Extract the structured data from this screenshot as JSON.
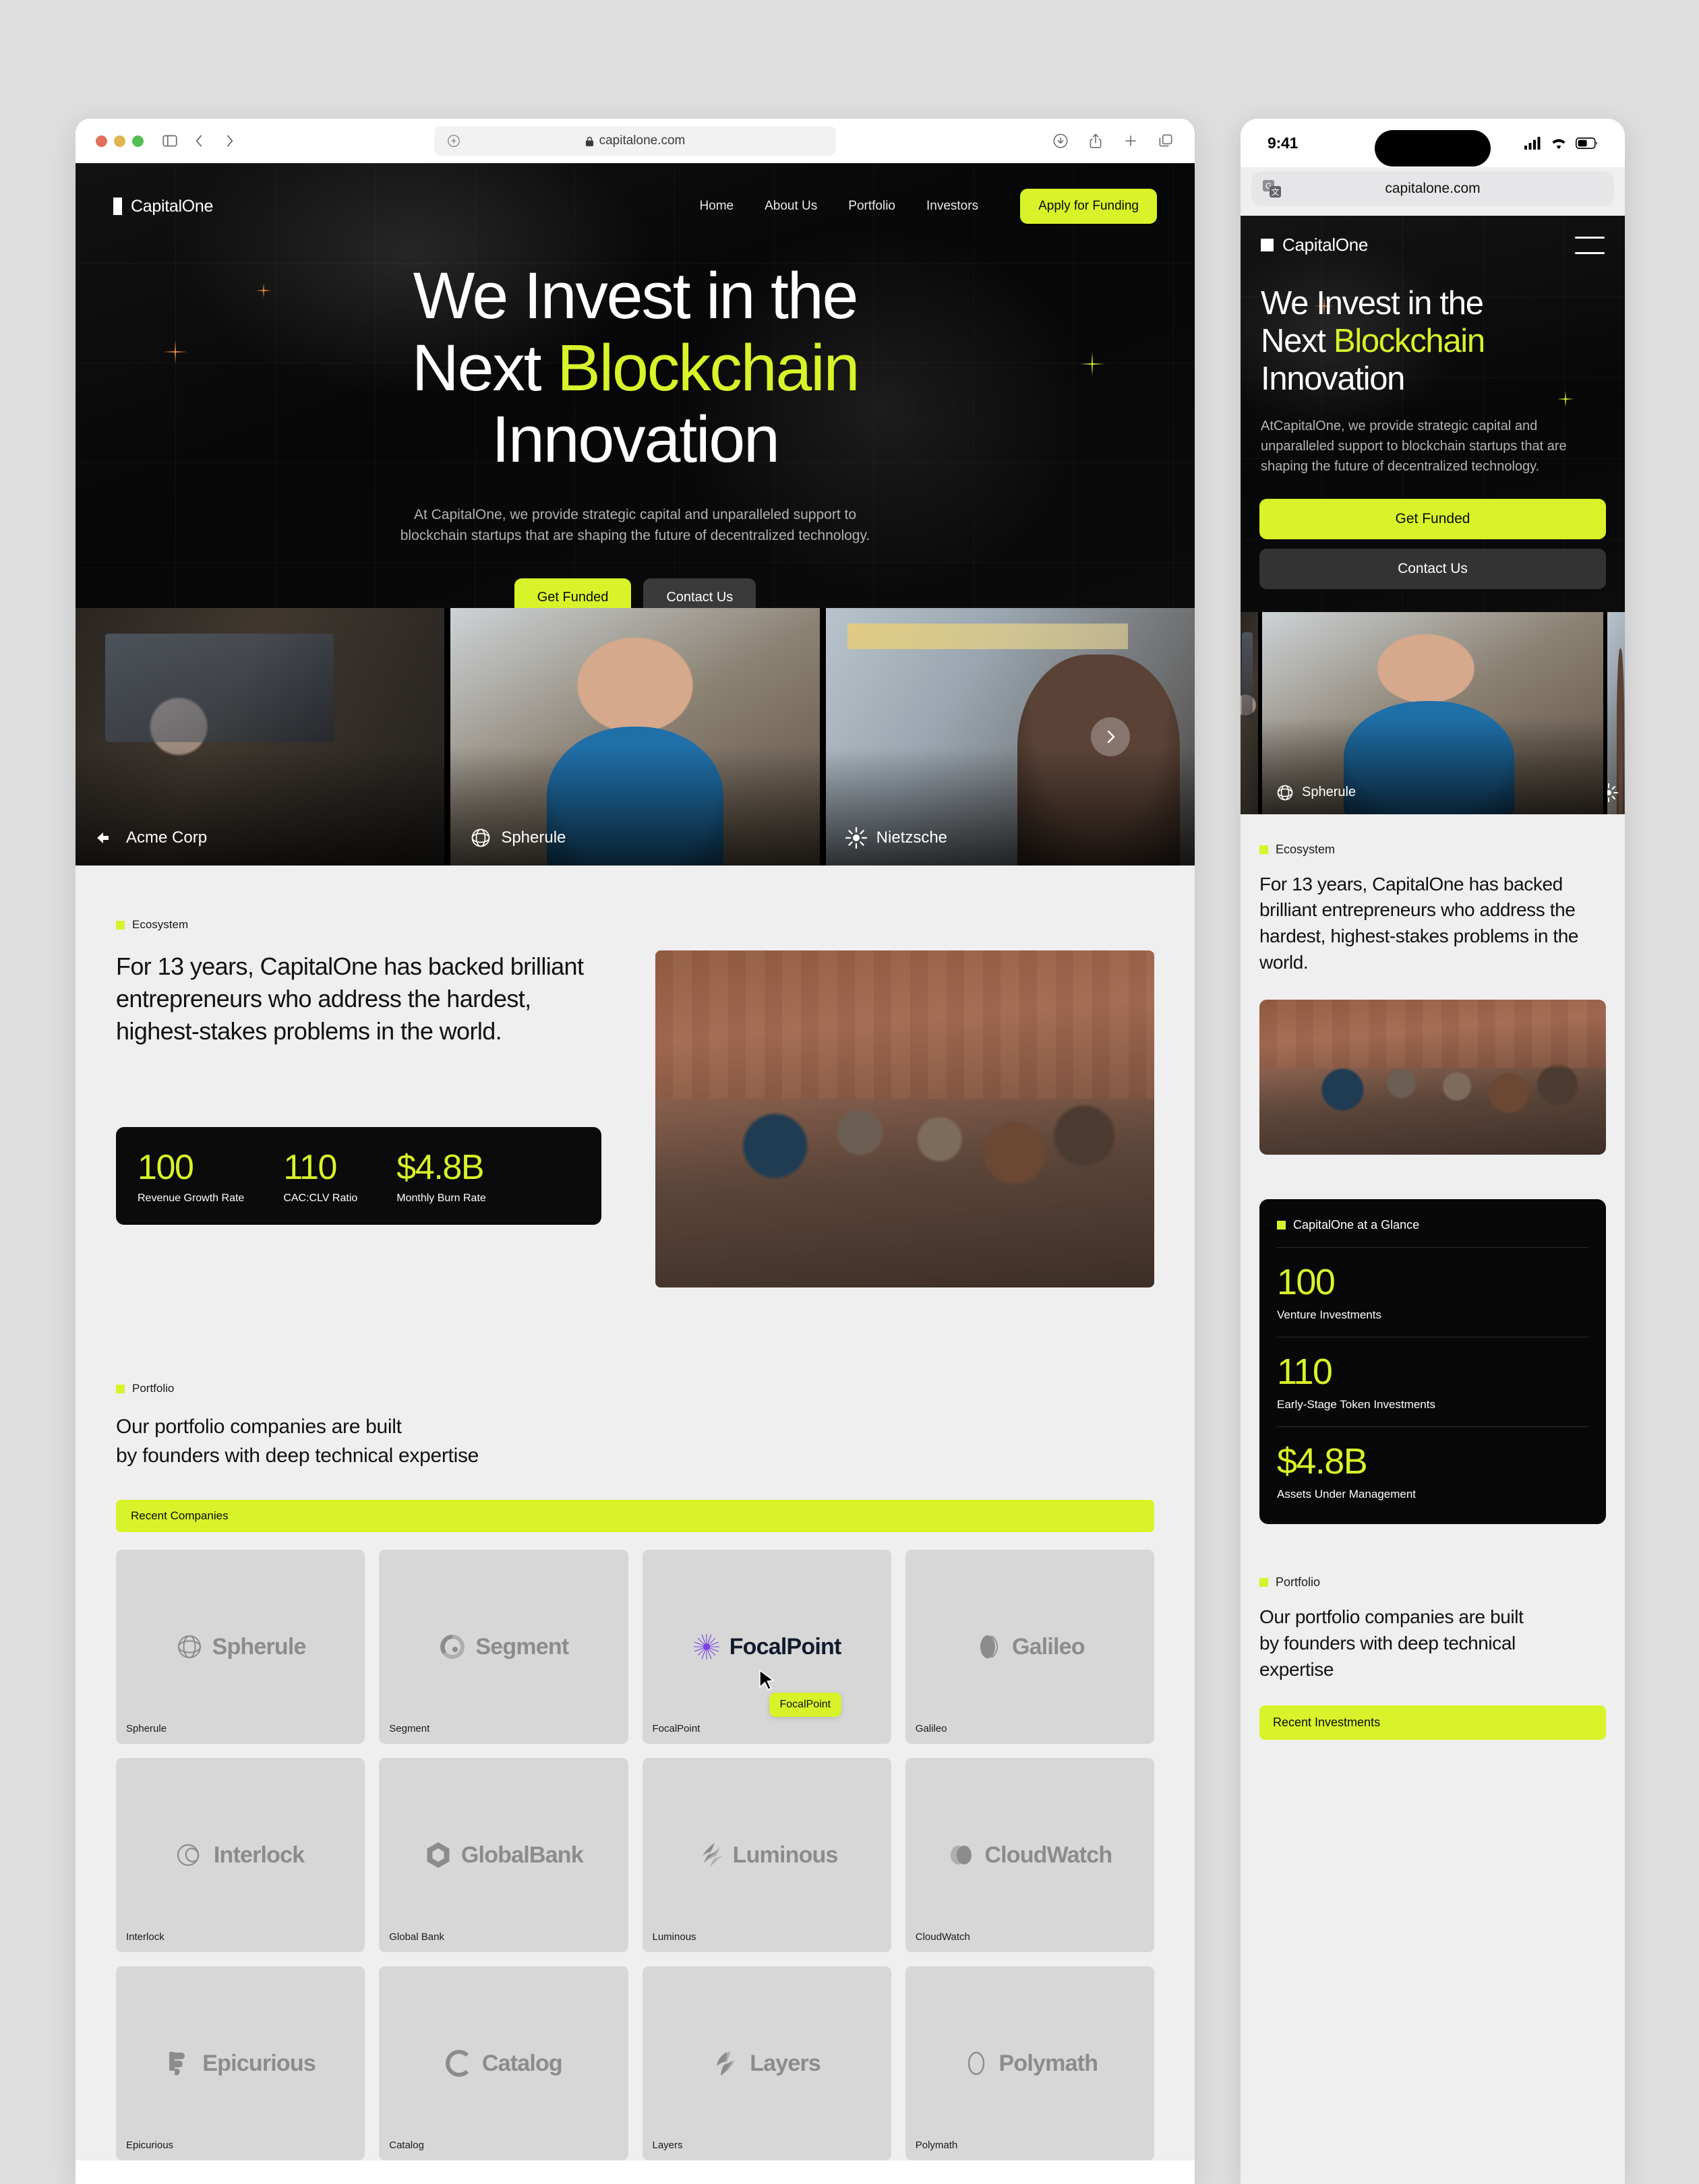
{
  "browser": {
    "url": "capitalone.com",
    "traffic_lights": [
      "close",
      "minimize",
      "maximize"
    ],
    "toolbar_icons": [
      "sidebar-icon",
      "back-icon",
      "forward-icon",
      "downloads-icon",
      "share-icon",
      "new-tab-icon",
      "tab-overview-icon"
    ]
  },
  "colors": {
    "accent_lime": "#d8f32a",
    "dark": "#0b0b0b",
    "page_bg": "#efefef",
    "card_bg": "#d7d7d7"
  },
  "site": {
    "brand": "CapitalOne",
    "nav": [
      {
        "label": "Home"
      },
      {
        "label": "About Us"
      },
      {
        "label": "Portfolio"
      },
      {
        "label": "Investors"
      }
    ],
    "cta": "Apply for Funding",
    "hero": {
      "line1": "We Invest in the",
      "line2_prefix": "Next ",
      "line2_highlight": "Blockchain",
      "line3": "Innovation",
      "subtitle": "At CapitalOne, we provide strategic capital and unparalleled support to blockchain startups that are shaping the future of decentralized technology.",
      "primary_button": "Get Funded",
      "secondary_button": "Contact Us"
    },
    "carousel": {
      "slides": [
        {
          "name": "Acme Corp",
          "icon": "acme-arrow-icon"
        },
        {
          "name": "Spherule",
          "icon": "spherule-circle-icon"
        },
        {
          "name": "Nietzsche",
          "icon": "nietzsche-sun-icon"
        }
      ],
      "next_label": "Next"
    },
    "ecosystem": {
      "eyebrow": "Ecosystem",
      "heading": "For 13 years, CapitalOne has backed brilliant entrepreneurs who address the hardest, highest-stakes problems in the world.",
      "stats": [
        {
          "value": "100",
          "label": "Revenue Growth Rate"
        },
        {
          "value": "110",
          "label": "CAC:CLV Ratio"
        },
        {
          "value": "$4.8B",
          "label": "Monthly Burn Rate"
        }
      ]
    },
    "portfolio": {
      "eyebrow": "Portfolio",
      "heading_line1": "Our portfolio companies are built",
      "heading_line2": "by founders with deep technical expertise",
      "bar_label": "Recent Companies",
      "companies": [
        {
          "logo_text": "Spherule",
          "name": "Spherule",
          "icon": "spherule-logo-icon"
        },
        {
          "logo_text": "Segment",
          "name": "Segment",
          "icon": "segment-logo-icon"
        },
        {
          "logo_text": "FocalPoint",
          "name": "FocalPoint",
          "icon": "focalpoint-logo-icon"
        },
        {
          "logo_text": "Galileo",
          "name": "Galileo",
          "icon": "galileo-logo-icon"
        },
        {
          "logo_text": "Interlock",
          "name": "Interlock",
          "icon": "interlock-logo-icon"
        },
        {
          "logo_text": "GlobalBank",
          "name": "Global Bank",
          "icon": "globalbank-logo-icon"
        },
        {
          "logo_text": "Luminous",
          "name": "Luminous",
          "icon": "luminous-logo-icon"
        },
        {
          "logo_text": "CloudWatch",
          "name": "CloudWatch",
          "icon": "cloudwatch-logo-icon"
        },
        {
          "logo_text": "Epicurious",
          "name": "Epicurious",
          "icon": "epicurious-logo-icon"
        },
        {
          "logo_text": "Catalog",
          "name": "Catalog",
          "icon": "catalog-logo-icon"
        },
        {
          "logo_text": "Layers",
          "name": "Layers",
          "icon": "layers-logo-icon"
        },
        {
          "logo_text": "Polymath",
          "name": "Polymath",
          "icon": "polymath-logo-icon"
        }
      ],
      "hover_tooltip": "FocalPoint"
    }
  },
  "mobile": {
    "status": {
      "time": "9:41",
      "signal": "signal-bars-icon",
      "wifi": "wifi-icon",
      "battery": "battery-icon"
    },
    "url": "capitalone.com",
    "brand": "CapitalOne",
    "menu_icon": "hamburger-menu-icon",
    "hero": {
      "line1": "We Invest in the",
      "line2_prefix": "Next ",
      "line2_highlight": "Blockchain",
      "line3": "Innovation",
      "subtitle": "AtCapitalOne, we provide strategic capital and unparalleled support to blockchain startups that are shaping the future of decentralized technology.",
      "primary_button": "Get Funded",
      "secondary_button": "Contact Us"
    },
    "carousel": {
      "visible_label": "Spherule"
    },
    "ecosystem": {
      "eyebrow": "Ecosystem",
      "heading": "For 13 years, CapitalOne has backed brilliant entrepreneurs who address the hardest, highest-stakes problems in the world."
    },
    "glance": {
      "eyebrow": "CapitalOne at a Glance",
      "stats": [
        {
          "value": "100",
          "label": "Venture Investments"
        },
        {
          "value": "110",
          "label": "Early-Stage Token Investments"
        },
        {
          "value": "$4.8B",
          "label": "Assets Under Management"
        }
      ]
    },
    "portfolio": {
      "eyebrow": "Portfolio",
      "heading_line1": "Our portfolio companies are built",
      "heading_line2": "by founders with deep technical",
      "heading_line3": "expertise",
      "bar_label": "Recent Investments"
    }
  }
}
